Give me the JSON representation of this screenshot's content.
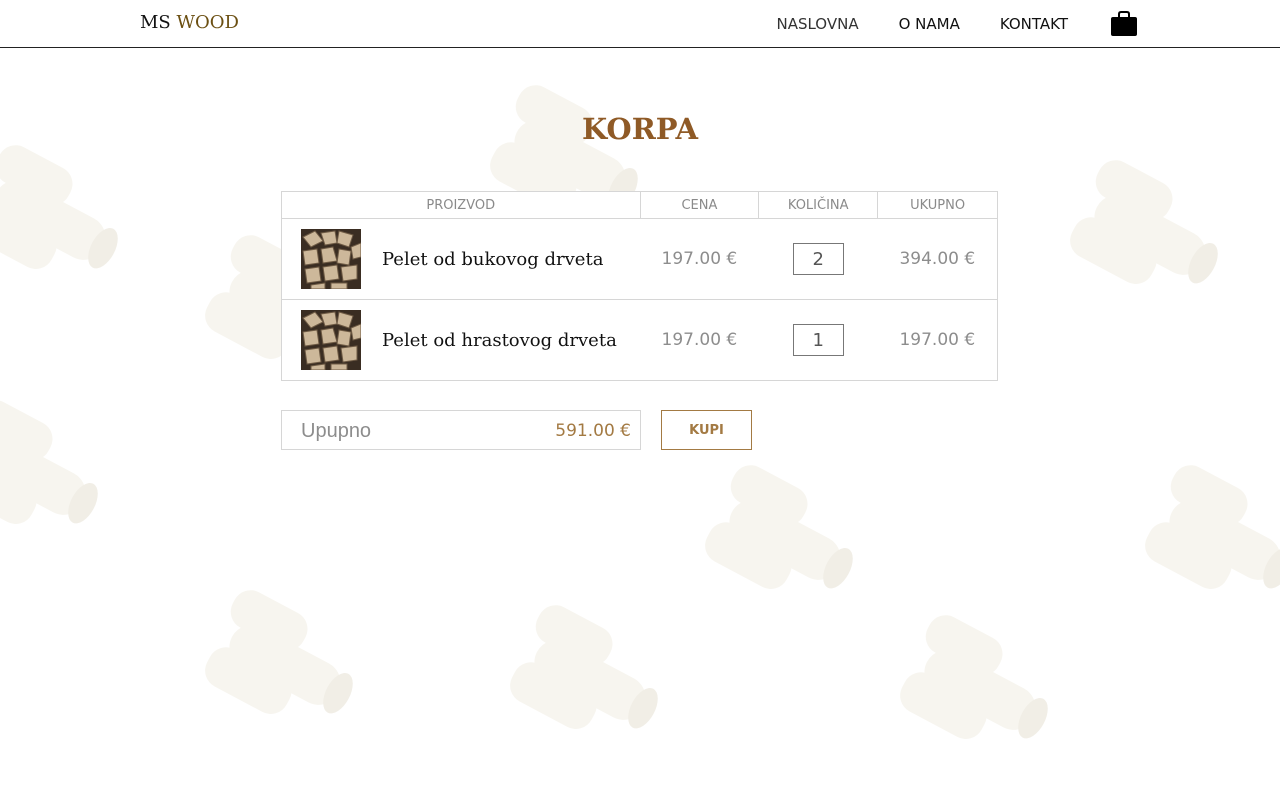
{
  "header": {
    "logo_ms": "MS",
    "logo_wood": "WOOD",
    "nav": [
      "NASLOVNA",
      "O NAMA",
      "KONTAKT"
    ],
    "bag_icon": "shopping-bag-icon"
  },
  "page": {
    "title": "KORPA"
  },
  "cart": {
    "columns": [
      "PROIZVOD",
      "CENA",
      "KOLIČINA",
      "UKUPNO"
    ],
    "items": [
      {
        "name": "Pelet od bukovog drveta",
        "price": "197.00 €",
        "quantity": "2",
        "total": "394.00 €",
        "image_icon": "wood-pellet-thumbnail"
      },
      {
        "name": "Pelet od hrastovog drveta",
        "price": "197.00 €",
        "quantity": "1",
        "total": "197.00 €",
        "image_icon": "wood-pellet-thumbnail"
      }
    ]
  },
  "summary": {
    "label": "Upupno",
    "value": "591.00 €"
  },
  "actions": {
    "buy_label": "KUPI"
  },
  "colors": {
    "accent": "#8f5a26",
    "accent_light": "#a37a43",
    "logo_brown": "#6b4f12",
    "muted": "#8d8d8d",
    "border": "#d6d6d6"
  }
}
